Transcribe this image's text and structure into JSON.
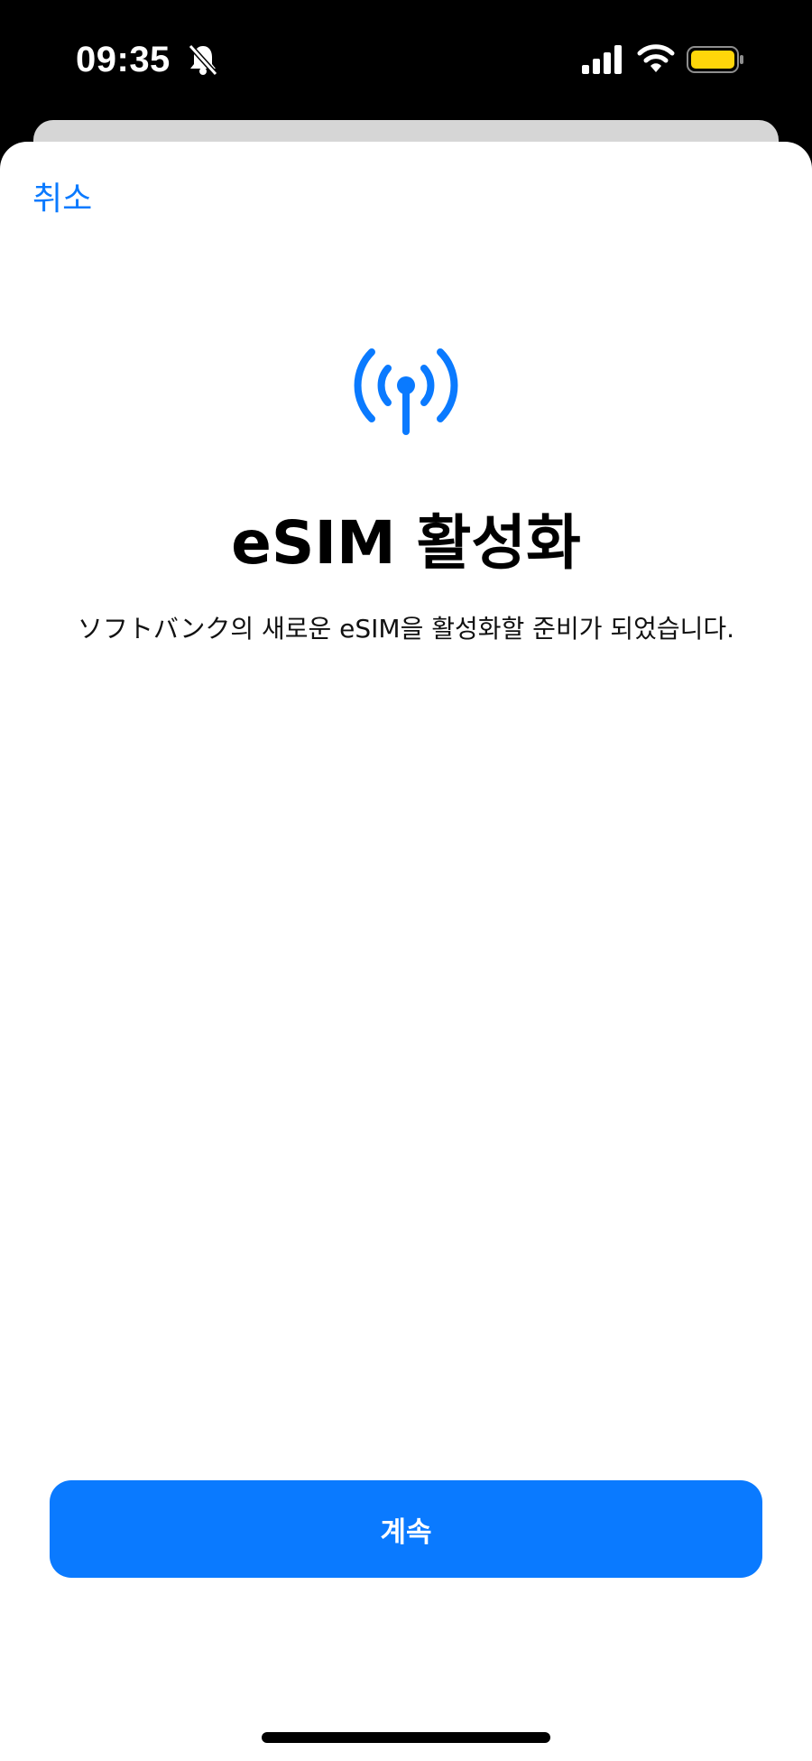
{
  "status_bar": {
    "time": "09:35",
    "silent_icon": "bell-slash-icon",
    "signal_icon": "cellular-signal-icon",
    "wifi_icon": "wifi-icon",
    "battery_icon": "battery-icon",
    "battery_color": "#ffd60a"
  },
  "nav": {
    "cancel_label": "취소"
  },
  "content": {
    "icon": "antenna-icon",
    "title": "eSIM 활성화",
    "description": "ソフトバンク의 새로운 eSIM을 활성화할 준비가 되었습니다."
  },
  "actions": {
    "continue_label": "계속"
  },
  "colors": {
    "accent": "#0a7aff"
  }
}
